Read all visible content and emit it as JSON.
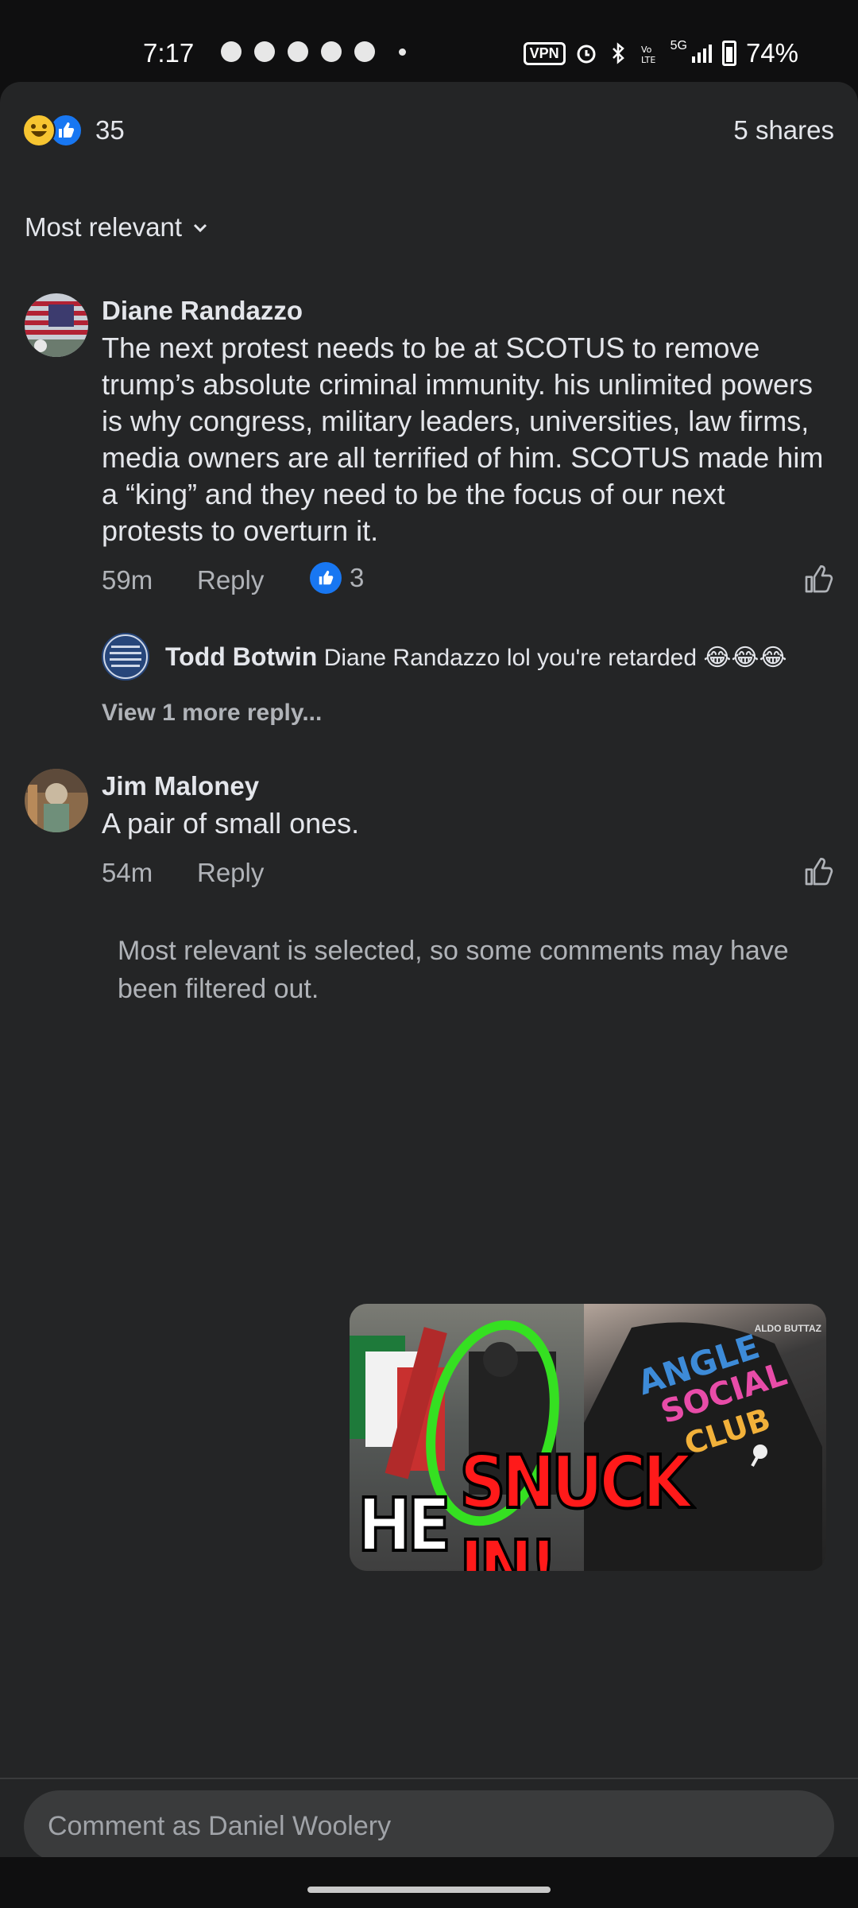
{
  "status_bar": {
    "time": "7:17",
    "vpn": "VPN",
    "network": "5G",
    "battery": "74%",
    "icons": [
      "chat-icon",
      "snapchat-icon",
      "messenger-icon",
      "messenger-icon",
      "messenger-icon",
      "dot-icon",
      "alarm-icon",
      "bluetooth-icon",
      "volte-icon",
      "signal-icon",
      "battery-icon"
    ]
  },
  "reactions": {
    "count": "35",
    "types": [
      "haha-icon",
      "like-icon"
    ],
    "shares": "5 shares"
  },
  "sort": {
    "label": "Most relevant"
  },
  "comments": [
    {
      "author": "Diane Randazzo",
      "text": "The next protest needs to be at SCOTUS to remove trump’s absolute criminal immunity. his unlimited powers is why congress, military leaders, universities, law firms, media owners are all terrified of him. SCOTUS made him a “king” and they need to be the focus of our next protests to overturn it.",
      "time": "59m",
      "reply_label": "Reply",
      "like_count": "3",
      "replies": [
        {
          "author": "Todd Botwin",
          "text": "Diane Randazzo lol you're retarded 😂😂😂"
        }
      ],
      "view_more": "View 1 more reply..."
    },
    {
      "author": "Jim Maloney",
      "text": "A pair of small ones.",
      "time": "54m",
      "reply_label": "Reply"
    }
  ],
  "filter_note": "Most relevant is selected, so some comments may have been filtered out.",
  "video_pip": {
    "caption_white": "HE",
    "caption_red": "SNUCK IN!",
    "watermark": "ALDO BUTTAZ"
  },
  "composer": {
    "placeholder": "Comment as Daniel Woolery"
  },
  "colors": {
    "sheet_bg": "#242526",
    "text_primary": "#e4e6eb",
    "text_secondary": "#b0b3b8",
    "like_blue": "#1877f2"
  }
}
